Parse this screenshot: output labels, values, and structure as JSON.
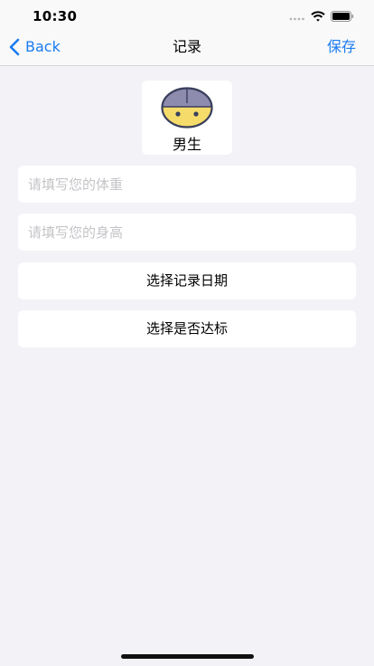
{
  "status_bar": {
    "time": "10:30"
  },
  "nav": {
    "back_label": "Back",
    "title": "记录",
    "save_label": "保存"
  },
  "avatar": {
    "label": "男生"
  },
  "form": {
    "weight_placeholder": "请填写您的体重",
    "height_placeholder": "请填写您的身高",
    "date_button": "选择记录日期",
    "standard_button": "选择是否达标"
  },
  "colors": {
    "accent": "#1a7cf0",
    "background": "#f2f2f7",
    "avatar_face": "#f5dc6a",
    "avatar_hair": "#8e8cae"
  }
}
